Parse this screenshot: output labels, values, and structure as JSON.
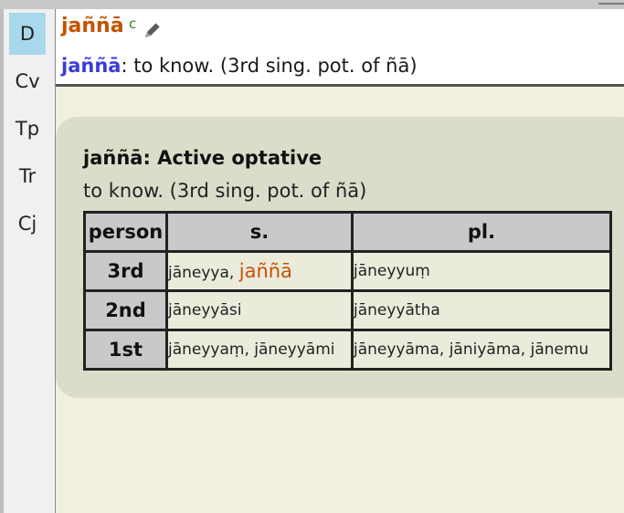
{
  "sidebar": {
    "tabs": [
      {
        "label": "D",
        "active": true
      },
      {
        "label": "Cv",
        "active": false
      },
      {
        "label": "Tp",
        "active": false
      },
      {
        "label": "Tr",
        "active": false
      },
      {
        "label": "Cj",
        "active": false
      }
    ]
  },
  "header": {
    "headword": "jaññā",
    "grammar_tag": "c",
    "edit_icon": "pencil-icon",
    "definition_word": "jaññā",
    "definition_text": ": to know. (3rd sing. pot. of ñā)"
  },
  "card": {
    "title": "jaññā: Active optative",
    "subtitle": "to know. (3rd sing. pot. of ñā)",
    "table": {
      "headers": [
        "person",
        "s.",
        "pl."
      ],
      "rows": [
        {
          "person": "3rd",
          "singular": "jāneyya, ",
          "singular_highlight": "jaññā",
          "plural": "jāneyyuṃ"
        },
        {
          "person": "2nd",
          "singular": "jāneyyāsi",
          "singular_highlight": "",
          "plural": "jāneyyātha"
        },
        {
          "person": "1st",
          "singular": "jāneyyaṃ, jāneyyāmi",
          "singular_highlight": "",
          "plural": "jāneyyāma, jāniyāma, jānemu"
        }
      ]
    }
  },
  "colors": {
    "headword": "#c45200",
    "definition_word": "#3c3cd8",
    "grammar_tag": "#1f8a1f",
    "active_tab": "#a9d8ec"
  }
}
